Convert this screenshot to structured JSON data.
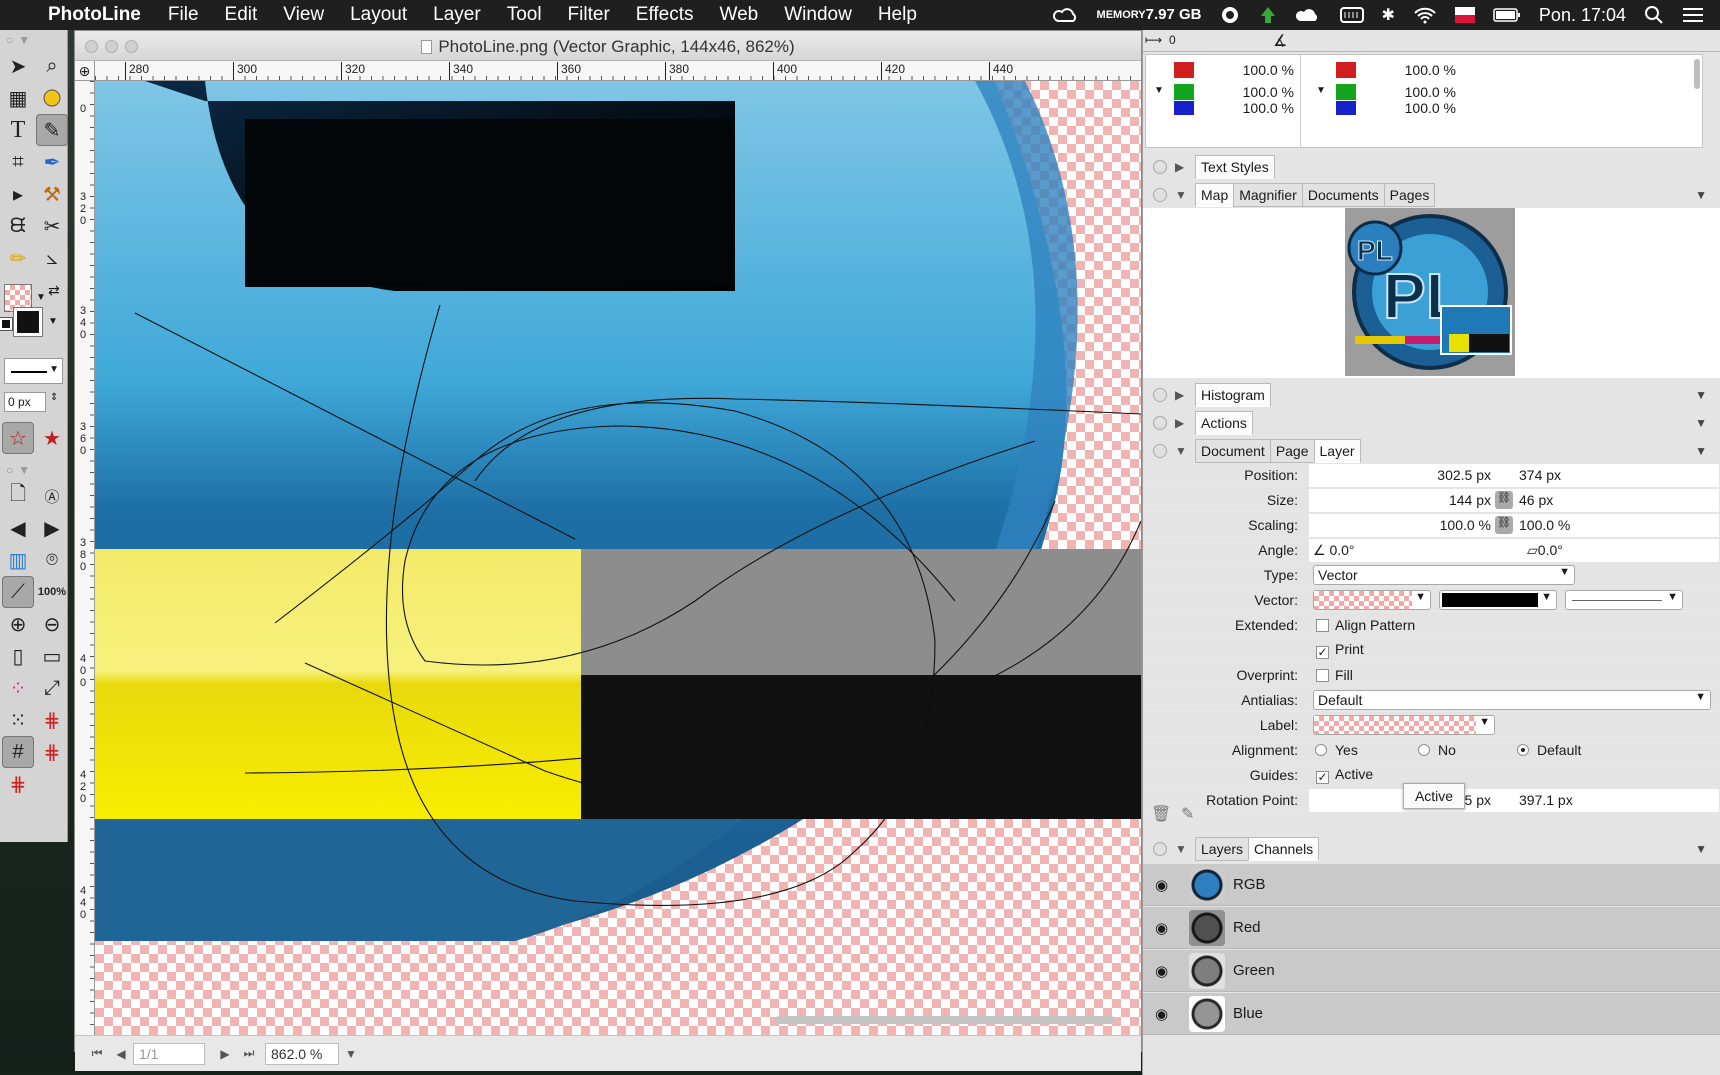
{
  "menubar": {
    "app_name": "PhotoLine",
    "items": [
      "File",
      "Edit",
      "View",
      "Layout",
      "Layer",
      "Tool",
      "Filter",
      "Effects",
      "Web",
      "Window",
      "Help"
    ],
    "memory_label": "MEMORY",
    "memory_value": "7.97 GB",
    "clock": "Pon. 17:04"
  },
  "document": {
    "title": "PhotoLine.png (Vector Graphic, 144x46, 862%)",
    "ruler_h": [
      "280",
      "300",
      "320",
      "340",
      "360",
      "380",
      "400",
      "420",
      "440"
    ],
    "ruler_v": [
      "0",
      "3 2 0",
      "3 4 0",
      "3 6 0",
      "3 8 0",
      "4 0 0",
      "4 2 0",
      "4 4 0"
    ],
    "page_field": "1/1",
    "zoom": "862.0 %"
  },
  "toolbox": {
    "line_width": "0 px",
    "zoom_100": "100%"
  },
  "color_panel": {
    "ruler_start": "0",
    "values_left": [
      "100.0 %",
      "100.0 %",
      "100.0 %"
    ],
    "values_right": [
      "100.0 %",
      "100.0 %",
      "100.0 %"
    ],
    "colors": {
      "red": "#d11e1e",
      "green": "#13a51e",
      "blue": "#1621c9"
    }
  },
  "panels": {
    "text_styles_tab": "Text Styles",
    "map_tabs": [
      "Map",
      "Magnifier",
      "Documents",
      "Pages"
    ],
    "histogram_tab": "Histogram",
    "actions_tab": "Actions",
    "props_tabs": [
      "Document",
      "Page",
      "Layer"
    ],
    "layers_tabs": [
      "Layers",
      "Channels"
    ]
  },
  "properties": {
    "position_label": "Position:",
    "position_x": "302.5 px",
    "position_y": "374 px",
    "size_label": "Size:",
    "size_w": "144 px",
    "size_h": "46 px",
    "scaling_label": "Scaling:",
    "scaling_x": "100.0 %",
    "scaling_y": "100.0 %",
    "angle_label": "Angle:",
    "angle_value": "0.0°",
    "shear_value": "0.0°",
    "type_label": "Type:",
    "type_value": "Vector",
    "vector_label": "Vector:",
    "extended_label": "Extended:",
    "align_pattern": "Align Pattern",
    "print": "Print",
    "overprint_label": "Overprint:",
    "fill": "Fill",
    "antialias_label": "Antialias:",
    "antialias_value": "Default",
    "label_label": "Label:",
    "alignment_label": "Alignment:",
    "align_yes": "Yes",
    "align_no": "No",
    "align_default": "Default",
    "guides_label": "Guides:",
    "guides_active": "Active",
    "rotation_label": "Rotation Point:",
    "rotation_x": "374.5 px",
    "rotation_y": "397.1 px"
  },
  "tooltip": "Active",
  "layers": [
    {
      "name": "RGB"
    },
    {
      "name": "Red"
    },
    {
      "name": "Green"
    },
    {
      "name": "Blue"
    }
  ]
}
